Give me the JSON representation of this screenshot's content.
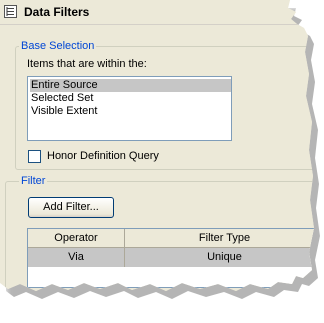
{
  "window": {
    "title": "Data Filters",
    "icon": "table-icon"
  },
  "base_selection": {
    "legend": "Base Selection",
    "items_label": "Items that are within the:",
    "options": [
      "Entire Source",
      "Selected Set",
      "Visible Extent"
    ],
    "selected_index": 0,
    "honor_definition_query": {
      "label": "Honor Definition Query",
      "checked": false
    }
  },
  "filter": {
    "legend": "Filter",
    "add_button_label": "Add Filter...",
    "columns": [
      "Operator",
      "Filter Type"
    ],
    "rows": [
      {
        "operator": "Via",
        "filter_type": "Unique"
      }
    ]
  }
}
